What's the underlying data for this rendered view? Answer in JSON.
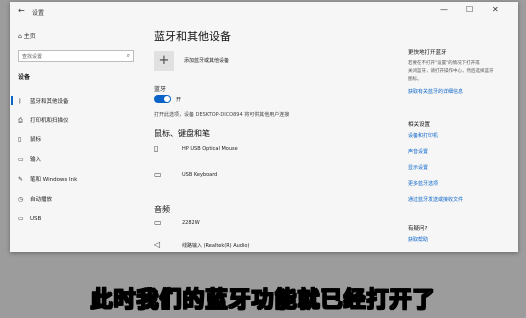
{
  "window": {
    "title": "设置",
    "minimize": "—",
    "maximize": "☐",
    "close": "✕"
  },
  "sidebar": {
    "home": "主页",
    "search_placeholder": "查找设置",
    "section": "设备",
    "items": [
      {
        "label": "蓝牙和其他设备",
        "icon": "bluetooth-icon",
        "active": true
      },
      {
        "label": "打印机和扫描仪",
        "icon": "printer-icon"
      },
      {
        "label": "鼠标",
        "icon": "mouse-icon"
      },
      {
        "label": "输入",
        "icon": "keyboard-icon"
      },
      {
        "label": "笔和 Windows Ink",
        "icon": "pen-icon"
      },
      {
        "label": "自动播放",
        "icon": "autoplay-icon"
      },
      {
        "label": "USB",
        "icon": "usb-icon"
      }
    ]
  },
  "main": {
    "title": "蓝牙和其他设备",
    "add_device": "添加蓝牙或其他设备",
    "bluetooth_label": "蓝牙",
    "bluetooth_state": "开",
    "discover_text": "打开此选项，设备 DESKTOP-DICO894 将可供其他用户连接",
    "section_input": "鼠标、键盘和笔",
    "input_devices": [
      "HP USB Optical Mouse",
      "USB Keyboard"
    ],
    "section_audio": "音频",
    "audio_devices": [
      "2282W",
      "线路输入 (Realtek(R) Audio)"
    ]
  },
  "right": {
    "faster_title": "更快地打开蓝牙",
    "faster_text": [
      "若要在不打开\"设置\"的情况下打开或",
      "关闭蓝牙，请打开操作中心，然后选择蓝牙",
      "图标。"
    ],
    "faster_link": "获取有关蓝牙的详细信息",
    "related_title": "相关设置",
    "related_links": [
      "设备和打印机",
      "声音设置",
      "显示设置",
      "更多蓝牙选项",
      "通过蓝牙发送或接收文件"
    ],
    "help_title": "有疑问?",
    "help_link": "获取帮助"
  },
  "caption": "此时我们的蓝牙功能就已经打开了"
}
